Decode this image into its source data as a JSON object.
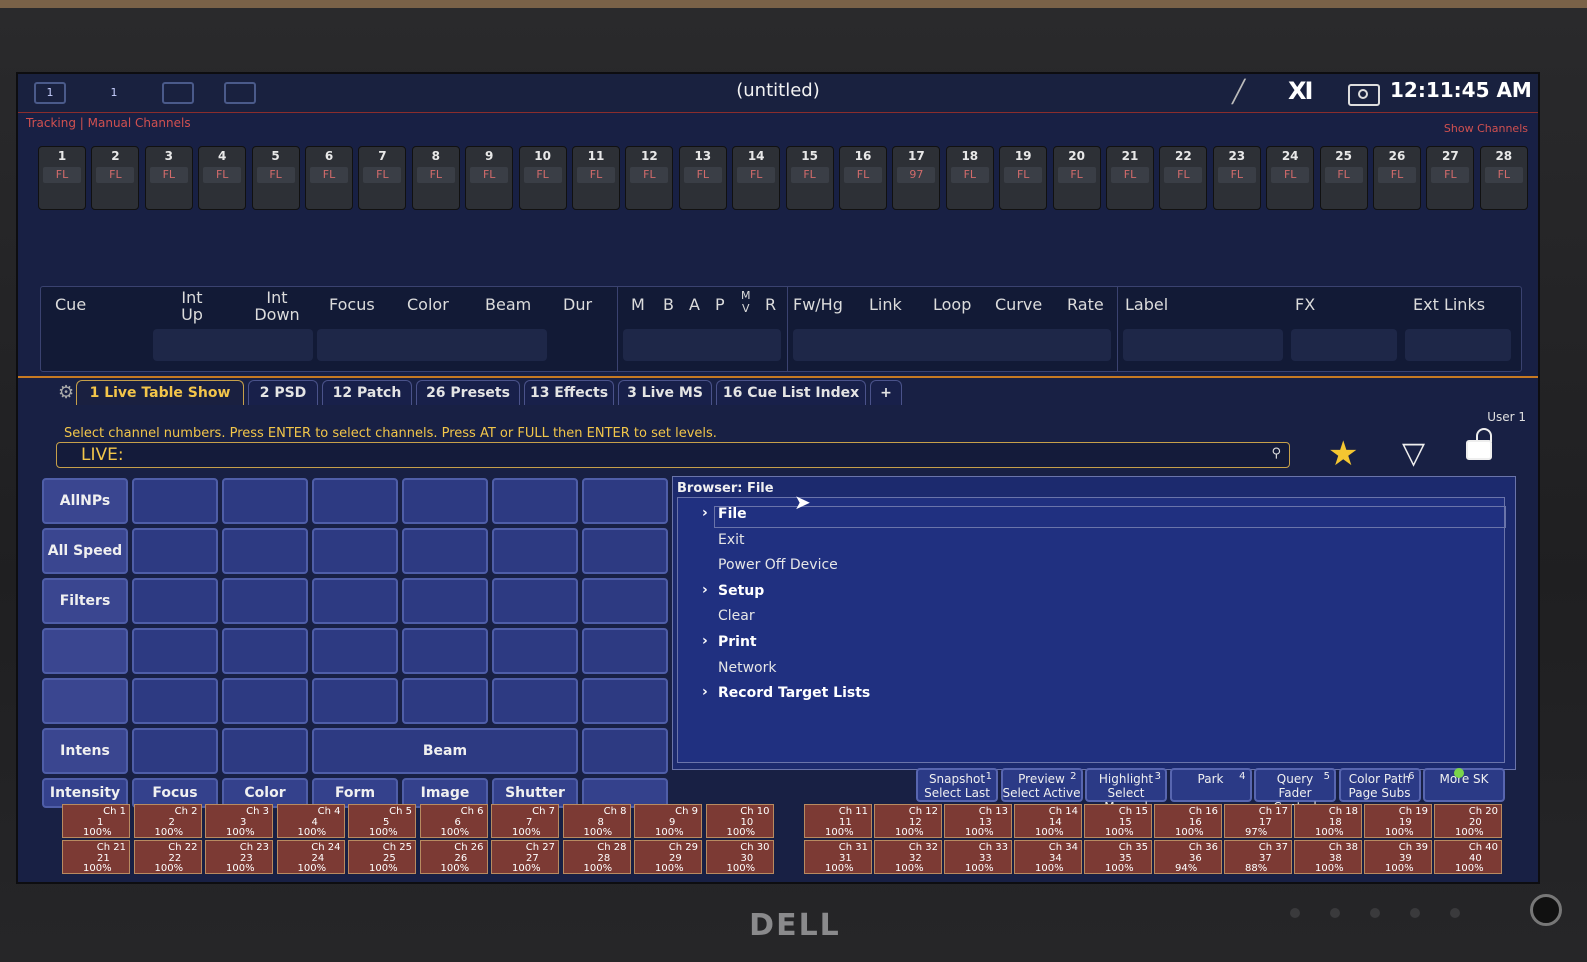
{
  "window": {
    "title": "(untitled)",
    "clock": "12:11:45 AM",
    "mode": "Tracking | Manual Channels",
    "show_channels": "Show Channels",
    "top_icons": [
      "1",
      "1",
      "",
      ""
    ]
  },
  "channels": [
    {
      "num": "1",
      "lvl": "FL"
    },
    {
      "num": "2",
      "lvl": "FL"
    },
    {
      "num": "3",
      "lvl": "FL"
    },
    {
      "num": "4",
      "lvl": "FL"
    },
    {
      "num": "5",
      "lvl": "FL"
    },
    {
      "num": "6",
      "lvl": "FL"
    },
    {
      "num": "7",
      "lvl": "FL"
    },
    {
      "num": "8",
      "lvl": "FL"
    },
    {
      "num": "9",
      "lvl": "FL"
    },
    {
      "num": "10",
      "lvl": "FL"
    },
    {
      "num": "11",
      "lvl": "FL"
    },
    {
      "num": "12",
      "lvl": "FL"
    },
    {
      "num": "13",
      "lvl": "FL"
    },
    {
      "num": "14",
      "lvl": "FL"
    },
    {
      "num": "15",
      "lvl": "FL"
    },
    {
      "num": "16",
      "lvl": "FL"
    },
    {
      "num": "17",
      "lvl": "97"
    },
    {
      "num": "18",
      "lvl": "FL"
    },
    {
      "num": "19",
      "lvl": "FL"
    },
    {
      "num": "20",
      "lvl": "FL"
    },
    {
      "num": "21",
      "lvl": "FL"
    },
    {
      "num": "22",
      "lvl": "FL"
    },
    {
      "num": "23",
      "lvl": "FL"
    },
    {
      "num": "24",
      "lvl": "FL"
    },
    {
      "num": "25",
      "lvl": "FL"
    },
    {
      "num": "26",
      "lvl": "FL"
    },
    {
      "num": "27",
      "lvl": "FL"
    },
    {
      "num": "28",
      "lvl": "FL"
    }
  ],
  "cue_columns": {
    "cue": "Cue",
    "int_up_1": "Int",
    "int_up_2": "Up",
    "int_down_1": "Int",
    "int_down_2": "Down",
    "focus": "Focus",
    "color": "Color",
    "beam": "Beam",
    "dur": "Dur",
    "m": "M",
    "b": "B",
    "a": "A",
    "p": "P",
    "mv_1": "M",
    "mv_2": "V",
    "r": "R",
    "fwhg": "Fw/Hg",
    "link": "Link",
    "loop": "Loop",
    "curve": "Curve",
    "rate": "Rate",
    "label": "Label",
    "fx": "FX",
    "ext_links": "Ext Links"
  },
  "tabs": [
    {
      "label": "1 Live Table Show",
      "active": true
    },
    {
      "label": "2 PSD",
      "active": false
    },
    {
      "label": "12 Patch",
      "active": false
    },
    {
      "label": "26 Presets",
      "active": false
    },
    {
      "label": "13 Effects",
      "active": false
    },
    {
      "label": "3 Live MS",
      "active": false
    },
    {
      "label": "16 Cue List Index",
      "active": false
    },
    {
      "label": "+",
      "active": false
    }
  ],
  "user": "User 1",
  "prompt": "Select channel numbers.  Press ENTER to select channels.  Press AT or FULL then ENTER to set levels.",
  "command_line": {
    "label": "LIVE:"
  },
  "grid": {
    "side": [
      "AllNPs",
      "All Speed",
      "Filters",
      "",
      "",
      "Intens"
    ],
    "beam": "Beam",
    "categories": [
      "Intensity",
      "Focus",
      "Color",
      "Form",
      "Image",
      "Shutter",
      ""
    ]
  },
  "browser": {
    "title": "Browser: File",
    "items": [
      {
        "label": "File",
        "folder": true
      },
      {
        "label": "Exit",
        "folder": false
      },
      {
        "label": "Power Off Device",
        "folder": false
      },
      {
        "label": "Setup",
        "folder": true
      },
      {
        "label": "Clear",
        "folder": false
      },
      {
        "label": "Print",
        "folder": true
      },
      {
        "label": "Network",
        "folder": false
      },
      {
        "label": "Record Target Lists",
        "folder": true
      }
    ]
  },
  "softkeys": [
    {
      "l1": "Snapshot",
      "l2": "Select Last",
      "n": "1"
    },
    {
      "l1": "Preview",
      "l2": "Select Active",
      "n": "2"
    },
    {
      "l1": "Highlight",
      "l2": "Select Manual",
      "n": "3"
    },
    {
      "l1": "",
      "l2": "Park",
      "n": "4"
    },
    {
      "l1": "Query",
      "l2": "Fader Control",
      "n": "5"
    },
    {
      "l1": "Color Path",
      "l2": "Page Subs",
      "n": "6"
    },
    {
      "l1": "",
      "l2": "More SK",
      "n": ""
    }
  ],
  "faders_top": [
    {
      "ch": "Ch 1",
      "n": "1",
      "p": "100%"
    },
    {
      "ch": "Ch 2",
      "n": "2",
      "p": "100%"
    },
    {
      "ch": "Ch 3",
      "n": "3",
      "p": "100%"
    },
    {
      "ch": "Ch 4",
      "n": "4",
      "p": "100%"
    },
    {
      "ch": "Ch 5",
      "n": "5",
      "p": "100%"
    },
    {
      "ch": "Ch 6",
      "n": "6",
      "p": "100%"
    },
    {
      "ch": "Ch 7",
      "n": "7",
      "p": "100%"
    },
    {
      "ch": "Ch 8",
      "n": "8",
      "p": "100%"
    },
    {
      "ch": "Ch 9",
      "n": "9",
      "p": "100%"
    },
    {
      "ch": "Ch 10",
      "n": "10",
      "p": "100%"
    },
    {
      "ch": "Ch 11",
      "n": "11",
      "p": "100%"
    },
    {
      "ch": "Ch 12",
      "n": "12",
      "p": "100%"
    },
    {
      "ch": "Ch 13",
      "n": "13",
      "p": "100%"
    },
    {
      "ch": "Ch 14",
      "n": "14",
      "p": "100%"
    },
    {
      "ch": "Ch 15",
      "n": "15",
      "p": "100%"
    },
    {
      "ch": "Ch 16",
      "n": "16",
      "p": "100%"
    },
    {
      "ch": "Ch 17",
      "n": "17",
      "p": "97%"
    },
    {
      "ch": "Ch 18",
      "n": "18",
      "p": "100%"
    },
    {
      "ch": "Ch 19",
      "n": "19",
      "p": "100%"
    },
    {
      "ch": "Ch 20",
      "n": "20",
      "p": "100%"
    }
  ],
  "faders_bottom": [
    {
      "ch": "Ch 21",
      "n": "21",
      "p": "100%"
    },
    {
      "ch": "Ch 22",
      "n": "22",
      "p": "100%"
    },
    {
      "ch": "Ch 23",
      "n": "23",
      "p": "100%"
    },
    {
      "ch": "Ch 24",
      "n": "24",
      "p": "100%"
    },
    {
      "ch": "Ch 25",
      "n": "25",
      "p": "100%"
    },
    {
      "ch": "Ch 26",
      "n": "26",
      "p": "100%"
    },
    {
      "ch": "Ch 27",
      "n": "27",
      "p": "100%"
    },
    {
      "ch": "Ch 28",
      "n": "28",
      "p": "100%"
    },
    {
      "ch": "Ch 29",
      "n": "29",
      "p": "100%"
    },
    {
      "ch": "Ch 30",
      "n": "30",
      "p": "100%"
    },
    {
      "ch": "Ch 31",
      "n": "31",
      "p": "100%"
    },
    {
      "ch": "Ch 32",
      "n": "32",
      "p": "100%"
    },
    {
      "ch": "Ch 33",
      "n": "33",
      "p": "100%"
    },
    {
      "ch": "Ch 34",
      "n": "34",
      "p": "100%"
    },
    {
      "ch": "Ch 35",
      "n": "35",
      "p": "100%"
    },
    {
      "ch": "Ch 36",
      "n": "36",
      "p": "94%"
    },
    {
      "ch": "Ch 37",
      "n": "37",
      "p": "88%"
    },
    {
      "ch": "Ch 38",
      "n": "38",
      "p": "100%"
    },
    {
      "ch": "Ch 39",
      "n": "39",
      "p": "100%"
    },
    {
      "ch": "Ch 40",
      "n": "40",
      "p": "100%"
    }
  ],
  "bezel": {
    "brand": "DELL"
  },
  "colors": {
    "accent": "#f2c64a",
    "screen": "#182044",
    "fader": "#7c3a34",
    "level_red": "#d26b6b"
  },
  "icons": [
    "gear-icon",
    "search-icon",
    "star-icon",
    "filter-icon",
    "lock-icon",
    "pen-icon",
    "camera-icon",
    "chevron-right-icon",
    "cursor-icon"
  ]
}
